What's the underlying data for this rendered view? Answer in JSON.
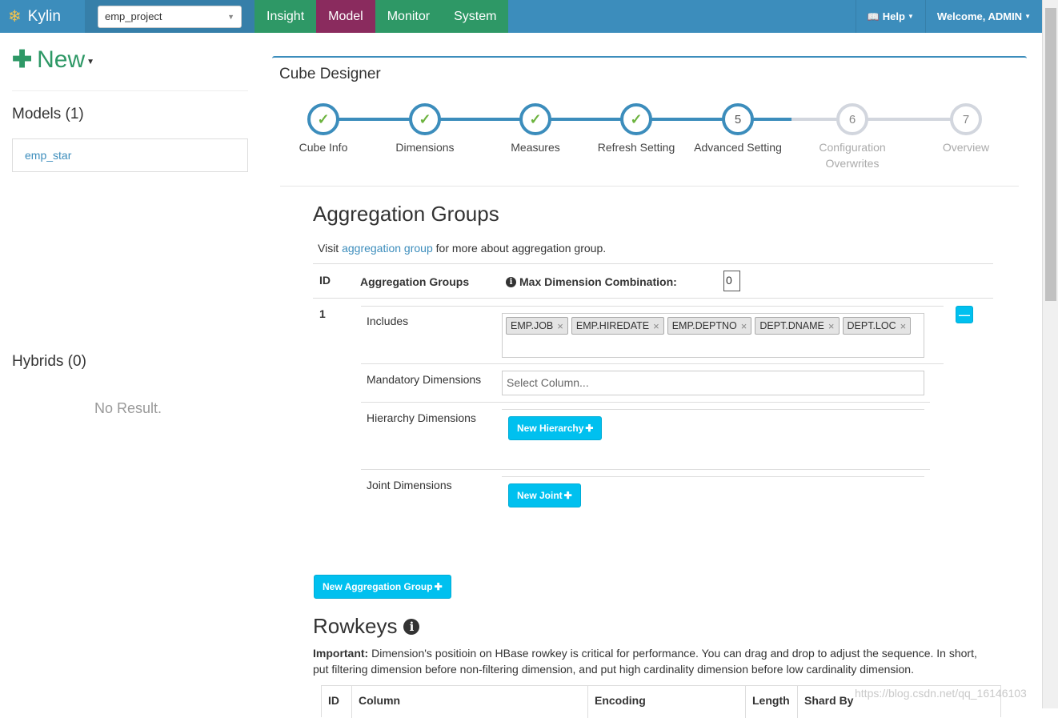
{
  "brand": {
    "name": "Kylin",
    "logo_icon": "kylin-logo-icon"
  },
  "project": {
    "selected": "emp_project"
  },
  "nav": {
    "tabs": [
      {
        "label": "Insight",
        "active": false
      },
      {
        "label": "Model",
        "active": true
      },
      {
        "label": "Monitor",
        "active": false
      },
      {
        "label": "System",
        "active": false
      }
    ],
    "help_label": "Help",
    "welcome_label": "Welcome, ADMIN"
  },
  "colors": {
    "topbar": "#3c8dbc",
    "nav_tab": "#2e9866",
    "nav_tab_active": "#8a2b5e",
    "accent": "#00c0ef",
    "check": "#6cb33e"
  },
  "sidebar": {
    "new_label": "New",
    "models_heading": "Models (1)",
    "models": [
      "emp_star"
    ],
    "hybrids_heading": "Hybrids (0)",
    "no_result": "No Result."
  },
  "designer": {
    "title": "Cube Designer",
    "steps": [
      {
        "number": "1",
        "label": "Cube Info",
        "status": "done"
      },
      {
        "number": "2",
        "label": "Dimensions",
        "status": "done"
      },
      {
        "number": "3",
        "label": "Measures",
        "status": "done"
      },
      {
        "number": "4",
        "label": "Refresh Setting",
        "status": "done"
      },
      {
        "number": "5",
        "label": "Advanced Setting",
        "status": "current"
      },
      {
        "number": "6",
        "label": "Configuration Overwrites",
        "status": "pending"
      },
      {
        "number": "7",
        "label": "Overview",
        "status": "pending"
      }
    ]
  },
  "aggregation": {
    "title": "Aggregation Groups",
    "visit_prefix": "Visit",
    "visit_link": "aggregation group",
    "visit_suffix": "for more about aggregation group.",
    "headers": {
      "id": "ID",
      "groups": "Aggregation Groups",
      "max_combination": "Max Dimension Combination:"
    },
    "max_combination_value": "0",
    "groups": [
      {
        "id": "1",
        "includes_label": "Includes",
        "includes": [
          "EMP.JOB",
          "EMP.HIREDATE",
          "EMP.DEPTNO",
          "DEPT.DNAME",
          "DEPT.LOC"
        ],
        "mandatory_label": "Mandatory Dimensions",
        "mandatory_placeholder": "Select Column...",
        "hierarchy_label": "Hierarchy Dimensions",
        "new_hierarchy_label": "New Hierarchy",
        "joint_label": "Joint Dimensions",
        "new_joint_label": "New Joint"
      }
    ],
    "new_group_label": "New Aggregation Group"
  },
  "rowkeys": {
    "title": "Rowkeys",
    "note_bold": "Important:",
    "note_text": " Dimension's positioin on HBase rowkey is critical for performance. You can drag and drop to adjust the sequence. In short, put filtering dimension before non-filtering dimension, and put high cardinality dimension before low cardinality dimension.",
    "columns": [
      "ID",
      "Column",
      "Encoding",
      "Length",
      "Shard By"
    ]
  },
  "watermark": "https://blog.csdn.net/qq_16146103"
}
